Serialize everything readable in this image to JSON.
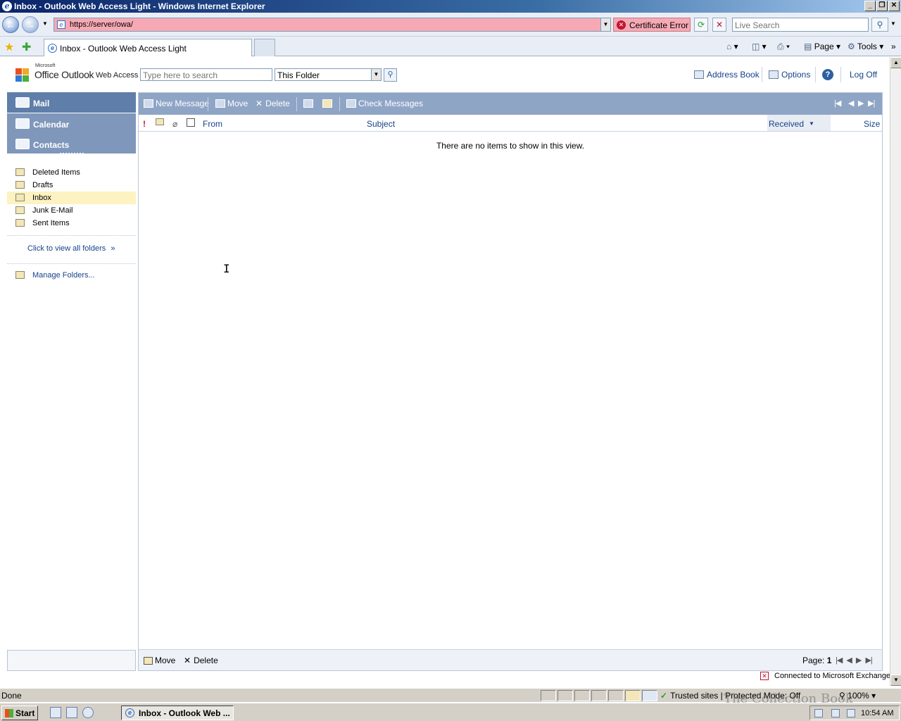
{
  "browser": {
    "window_title": "Inbox - Outlook Web Access Light - Windows Internet Explorer",
    "url": "https://server/owa/",
    "certificate_error": "Certificate Error",
    "search_placeholder": "Live Search",
    "tab_title": "Inbox - Outlook Web Access Light",
    "commands": {
      "page": "Page",
      "tools": "Tools"
    }
  },
  "owa": {
    "logo": {
      "microsoft": "Microsoft",
      "product": "Office Outlook",
      "suffix": "Web Access"
    },
    "search": {
      "placeholder": "Type here to search",
      "scope": "This Folder"
    },
    "header_links": {
      "address_book": "Address Book",
      "options": "Options",
      "help": "?",
      "log_off": "Log Off"
    },
    "nav": {
      "mail": "Mail",
      "calendar": "Calendar",
      "contacts": "Contacts"
    },
    "folders": [
      {
        "label": "Deleted Items",
        "selected": false
      },
      {
        "label": "Drafts",
        "selected": false
      },
      {
        "label": "Inbox",
        "selected": true
      },
      {
        "label": "Junk E-Mail",
        "selected": false
      },
      {
        "label": "Sent Items",
        "selected": false
      }
    ],
    "view_all_folders": "Click to view all folders",
    "manage_folders": "Manage Folders...",
    "toolbar": {
      "new_message": "New Message",
      "move": "Move",
      "delete": "Delete",
      "check_messages": "Check Messages"
    },
    "columns": {
      "importance": "!",
      "from": "From",
      "subject": "Subject",
      "received": "Received",
      "size": "Size"
    },
    "empty_message": "There are no items to show in this view.",
    "bottom": {
      "move": "Move",
      "delete": "Delete",
      "page_label": "Page:",
      "page_number": "1"
    },
    "connection_status": "Connected to Microsoft Exchange"
  },
  "statusbar": {
    "status": "Done",
    "zone": "Trusted sites | Protected Mode: Off",
    "zoom": "100%",
    "watermark": "The Collection Book"
  },
  "taskbar": {
    "start": "Start",
    "task_item": "Inbox - Outlook Web ...",
    "clock": "10:54 AM"
  },
  "colors": {
    "nav_selected": "#5f7ea9",
    "nav_normal": "#7f97bb",
    "toolbar": "#8fa5c6",
    "folder_selected": "#fdf2c1",
    "address_error": "#f6a9b4"
  }
}
